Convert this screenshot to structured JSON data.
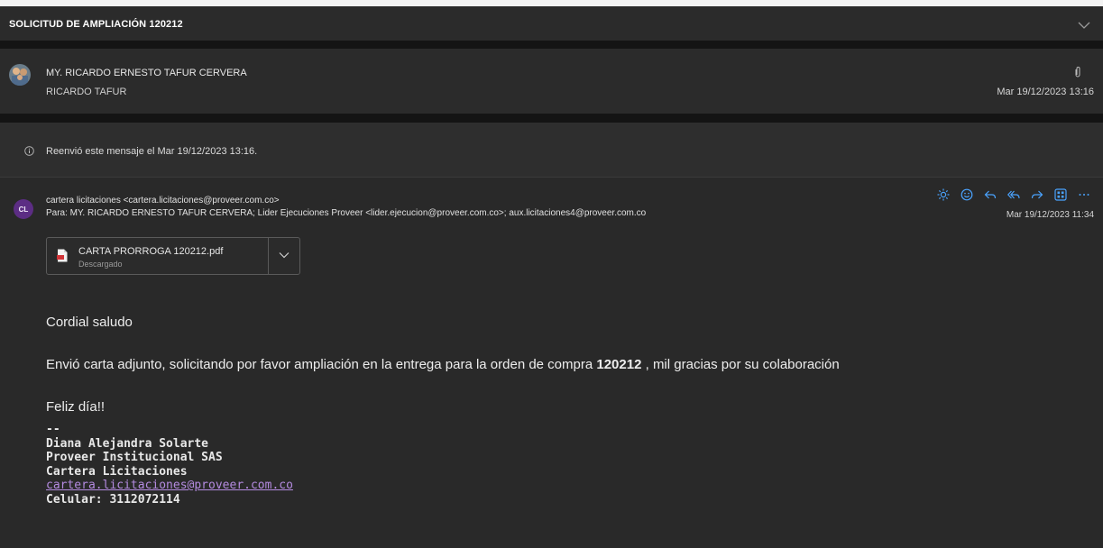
{
  "subject": "SOLICITUD DE AMPLIACIÓN 120212",
  "thread": {
    "sender_name": "MY. RICARDO ERNESTO TAFUR CERVERA",
    "sender_sub": "RICARDO TAFUR",
    "date": "Mar 19/12/2023 13:16"
  },
  "forward_note": "Reenvió este mensaje el Mar 19/12/2023 13:16.",
  "message": {
    "avatar_initials": "CL",
    "avatar_color": "#5c2d84",
    "from": "cartera licitaciones <cartera.licitaciones@proveer.com.co>",
    "to": "Para: MY. RICARDO ERNESTO TAFUR CERVERA;  Lider Ejecuciones Proveer <lider.ejecucion@proveer.com.co>;  aux.licitaciones4@proveer.com.co",
    "date": "Mar 19/12/2023 11:34",
    "attachment": {
      "name": "CARTA PRORROGA 120212.pdf",
      "status": "Descargado"
    },
    "greeting": "Cordial saludo",
    "body_pre": "Envió carta adjunto, solicitando por favor ampliación en la entrega para la orden de compra ",
    "body_bold": "120212",
    "body_post": " , mil gracias por su colaboración",
    "closing": "Feliz día!!",
    "signature": {
      "dashes": "--",
      "name": "Diana Alejandra Solarte",
      "company": "Proveer Institucional SAS",
      "department": "Cartera Licitaciones",
      "email": "cartera.licitaciones@proveer.com.co",
      "phone": "Celular: 3112072114"
    }
  },
  "icons": [
    "chevron-down-icon",
    "paperclip-icon",
    "info-icon",
    "sun-icon",
    "emoji-icon",
    "reply-icon",
    "reply-all-icon",
    "forward-icon",
    "apps-icon",
    "more-icon",
    "pdf-icon"
  ],
  "colors": {
    "background": "#292929",
    "accent_icons": "#4aa3ff",
    "link": "#b48be0"
  }
}
